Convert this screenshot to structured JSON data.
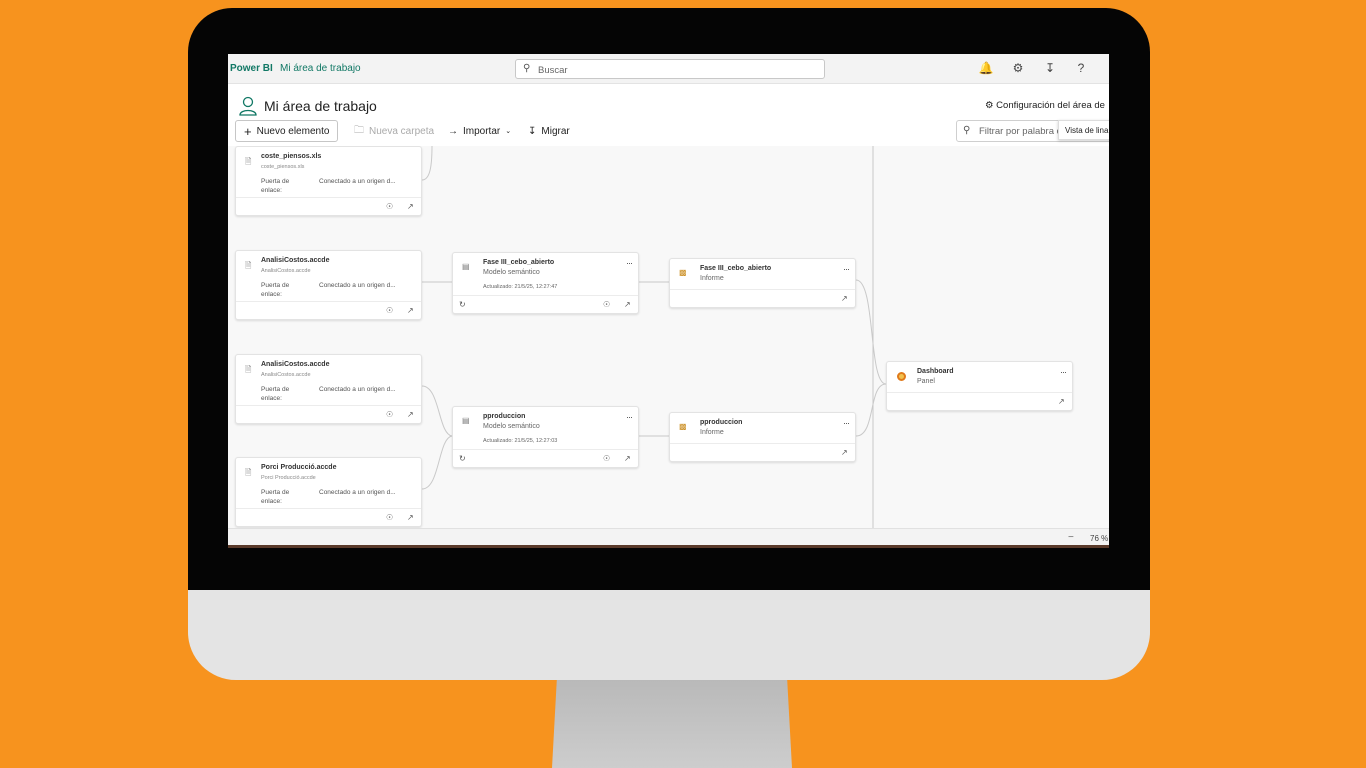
{
  "topbar": {
    "brand": "Power BI",
    "breadcrumb": "Mi área de trabajo",
    "search_placeholder": "Buscar"
  },
  "workspace": {
    "title": "Mi área de trabajo",
    "settings_label": "Configuración del área de"
  },
  "toolbar": {
    "new_item": "Nuevo elemento",
    "new_folder": "Nueva carpeta",
    "import": "Importar",
    "migrate": "Migrar",
    "filter_placeholder": "Filtrar por palabra c",
    "tooltip": "Vista de lina"
  },
  "sources": [
    {
      "name": "coste_piensos.xls",
      "file": "coste_piensos.xls",
      "gateway": "Puerta de enlace:",
      "connection": "Conectado a un origen d..."
    },
    {
      "name": "AnalisiCostos.accde",
      "file": "AnalisiCostos.accde",
      "gateway": "Puerta de enlace:",
      "connection": "Conectado a un origen d..."
    },
    {
      "name": "AnalisiCostos.accde",
      "file": "AnalisiCostos.accde",
      "gateway": "Puerta de enlace:",
      "connection": "Conectado a un origen d..."
    },
    {
      "name": "Porci Producció.accde",
      "file": "Porci Producció.accde",
      "gateway": "Puerta de enlace:",
      "connection": "Conectado a un origen d..."
    }
  ],
  "models": [
    {
      "name": "Fase III_cebo_abierto",
      "type": "Modelo semántico",
      "updated": "Actualizado: 21/5/25, 12:27:47"
    },
    {
      "name": "pproduccion",
      "type": "Modelo semántico",
      "updated": "Actualizado: 21/5/25, 12:27:03"
    }
  ],
  "reports": [
    {
      "name": "Fase III_cebo_abierto",
      "type": "Informe"
    },
    {
      "name": "pproduccion",
      "type": "Informe"
    }
  ],
  "dashboard": {
    "name": "Dashboard",
    "type": "Panel"
  },
  "more_label": "···",
  "statusbar": {
    "zoom_minus": "−",
    "zoom": "76 %"
  }
}
